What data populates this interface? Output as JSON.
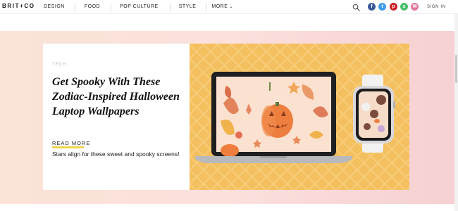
{
  "brand": {
    "logo": "BRIT+CO"
  },
  "nav": {
    "items": [
      {
        "label": "DESIGN"
      },
      {
        "label": "FOOD"
      },
      {
        "label": "POP CULTURE"
      },
      {
        "label": "STYLE"
      },
      {
        "label": "MORE"
      }
    ],
    "more_chevron": "⌄"
  },
  "header": {
    "search_icon": "search-icon",
    "social": [
      {
        "name": "facebook-icon",
        "glyph": "f",
        "color": "#3b5998"
      },
      {
        "name": "twitter-icon",
        "glyph": "t",
        "color": "#3d9ae8"
      },
      {
        "name": "pinterest-icon",
        "glyph": "p",
        "color": "#cb2027"
      },
      {
        "name": "spotify-icon",
        "glyph": "s",
        "color": "#4bbf6b"
      },
      {
        "name": "email-icon",
        "glyph": "✉",
        "color": "#e0769a"
      }
    ],
    "signin": "SIGN IN"
  },
  "feature": {
    "category": "TECH",
    "headline": "Get Spooky With These Zodiac-Inspired Halloween Laptop Wallpapers",
    "read_more": "READ MORE",
    "dek": "Stars align for these sweet and spooky screens!",
    "accent_color": "#f2d44a"
  }
}
